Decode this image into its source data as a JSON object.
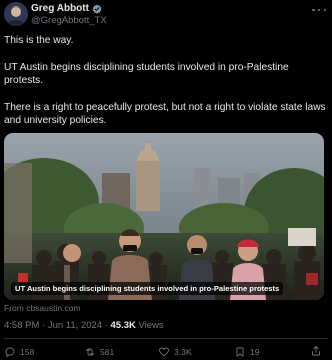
{
  "author": {
    "name": "Greg Abbott",
    "handle": "@GregAbbott_TX",
    "verified_icon": "verified-badge-icon",
    "verified_color": "#829aab"
  },
  "post": {
    "line1": "This is the way.",
    "line2": "UT Austin begins disciplining students involved in pro-Palestine protests.",
    "line3": "There is a right to peacefully protest, but not a right to violate state laws and university policies."
  },
  "media": {
    "caption": "UT Austin begins disciplining students involved in pro-Palestine protests",
    "source": "From cbsaustin.com"
  },
  "meta": {
    "time": "4:58 PM · Jun 11, 2024 · ",
    "views_count": "45.3K",
    "views_label": " Views"
  },
  "actions": {
    "replies": "158",
    "reposts": "581",
    "likes": "3.3K",
    "bookmarks": "19"
  },
  "colors": {
    "background": "#000000",
    "text": "#e7e9ea",
    "secondary": "#71767b",
    "divider": "#2f3336"
  }
}
